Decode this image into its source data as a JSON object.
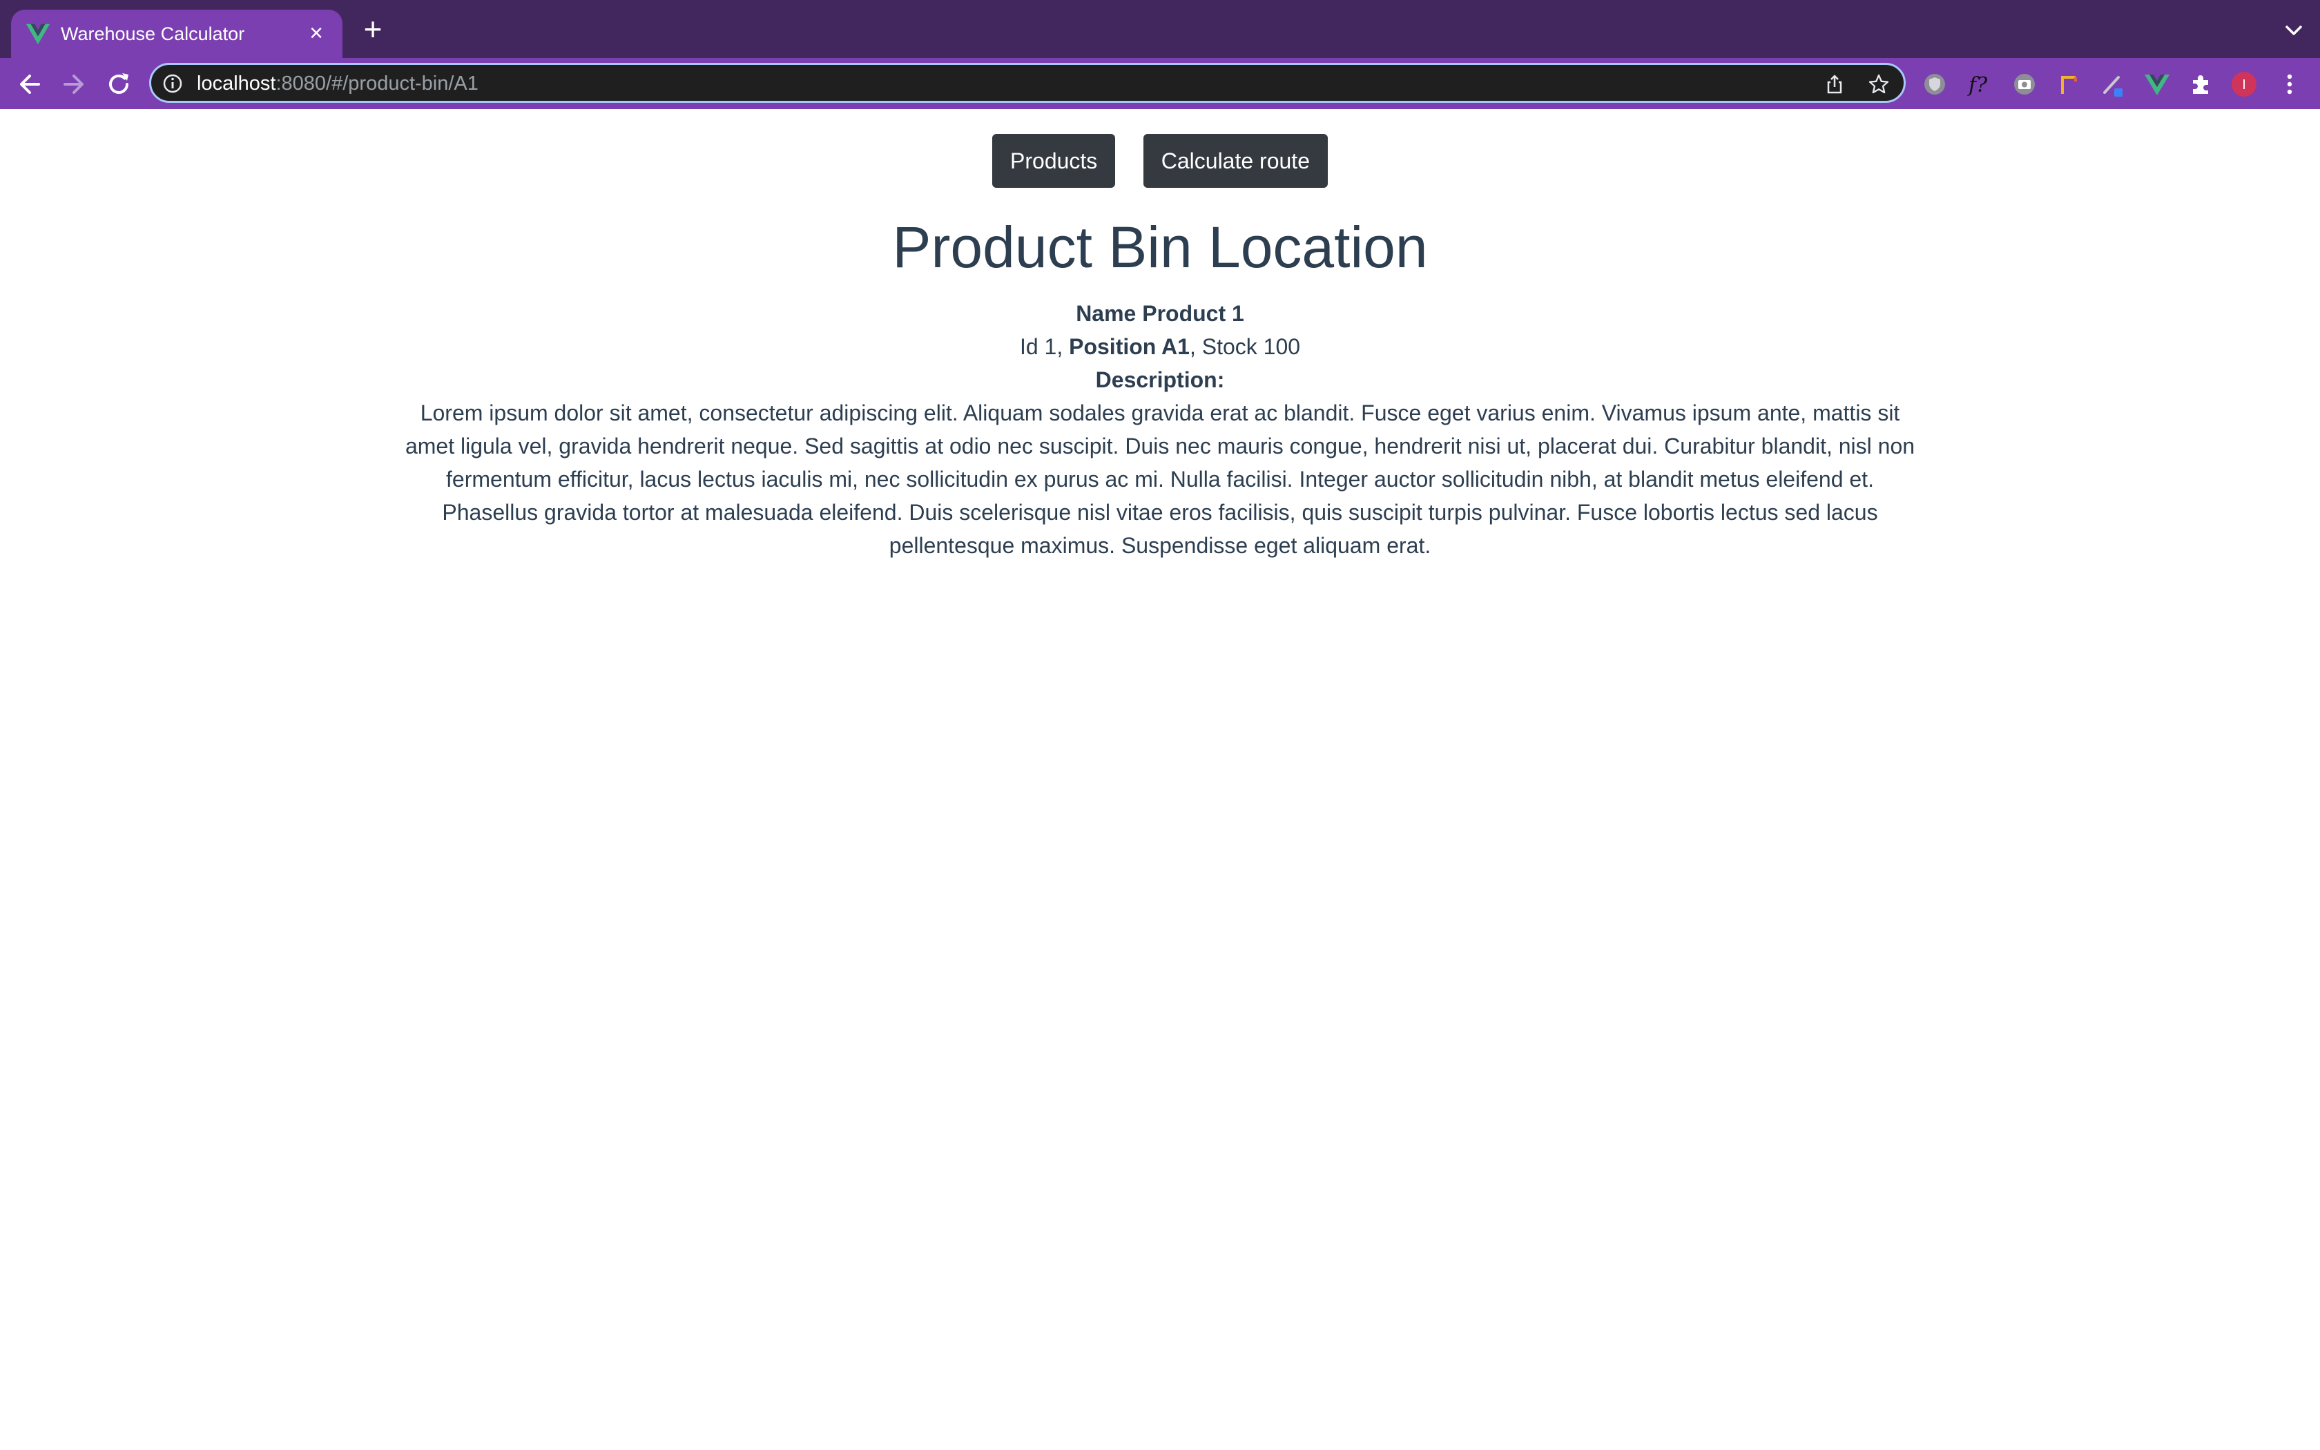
{
  "browser": {
    "tab": {
      "title": "Warehouse Calculator",
      "close": "×"
    },
    "new_tab": "+",
    "url": {
      "host": "localhost",
      "rest": ":8080/#/product-bin/A1"
    },
    "profile_initial": "I",
    "colors": {
      "tabstrip": "#42275e",
      "toolbar": "#7b3fb1",
      "omnibox": "#1f1f1f",
      "vue_green": "#41b883",
      "profile": "#d0345a"
    }
  },
  "nav": {
    "products_label": "Products",
    "calculate_route_label": "Calculate route"
  },
  "page": {
    "title": "Product Bin Location",
    "name_label": "Name",
    "name_value": "Product 1",
    "id_text": "Id 1, ",
    "position_text": "Position A1",
    "stock_text": ", Stock 100",
    "description_label": "Description:",
    "description_lines": [
      "Lorem ipsum dolor sit amet, consectetur adipiscing elit. Aliquam sodales gravida erat ac blandit. Fusce eget varius enim. Vivamus ipsum ante, mattis sit",
      "amet ligula vel, gravida hendrerit neque. Sed sagittis at odio nec suscipit. Duis nec mauris congue, hendrerit nisi ut, placerat dui. Curabitur blandit, nisl non",
      "fermentum efficitur, lacus lectus iaculis mi, nec sollicitudin ex purus ac mi. Nulla facilisi. Integer auctor sollicitudin nibh, at blandit metus eleifend et.",
      "Phasellus gravida tortor at malesuada eleifend. Duis scelerisque nisl vitae eros facilisis, quis suscipit turpis pulvinar. Fusce lobortis lectus sed lacus",
      "pellentesque maximus. Suspendisse eget aliquam erat."
    ]
  }
}
